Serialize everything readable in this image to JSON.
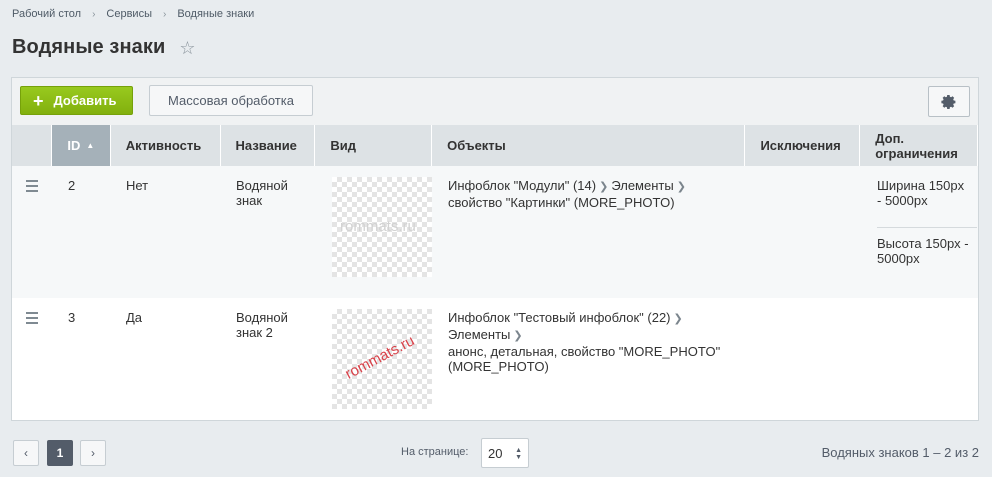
{
  "breadcrumb": [
    "Рабочий стол",
    "Сервисы",
    "Водяные знаки"
  ],
  "page_title": "Водяные знаки",
  "toolbar": {
    "add_label": "Добавить",
    "mass_label": "Массовая обработка"
  },
  "columns": {
    "id": "ID",
    "active": "Активность",
    "name": "Название",
    "view": "Вид",
    "objects": "Объекты",
    "exceptions": "Исключения",
    "limits": "Доп. ограничения"
  },
  "rows": [
    {
      "id": "2",
      "active": "Нет",
      "name": "Водяной знак",
      "watermark_text": "rommats.ru",
      "objects": {
        "infoblock": "Инфоблок \"Модули\" (14)",
        "elements": "Элементы",
        "property": "свойство \"Картинки\" (MORE_PHOTO)"
      },
      "limits": {
        "width": "Ширина 150px - 5000px",
        "height": "Высота 150px - 5000px"
      }
    },
    {
      "id": "3",
      "active": "Да",
      "name": "Водяной знак 2",
      "watermark_text": "rommats.ru",
      "objects": {
        "infoblock": "Инфоблок \"Тестовый инфоблок\" (22)",
        "elements": "Элементы",
        "property": "анонс, детальная, свойство \"MORE_PHOTO\" (MORE_PHOTO)"
      }
    }
  ],
  "footer": {
    "current_page": "1",
    "per_page_label": "На странице:",
    "per_page_value": "20",
    "summary": "Водяных знаков 1 – 2 из 2"
  },
  "colors": {
    "accent_green": "#8fbf16",
    "header_sorted": "#a5b1b9",
    "watermark_red": "#d9424a"
  }
}
